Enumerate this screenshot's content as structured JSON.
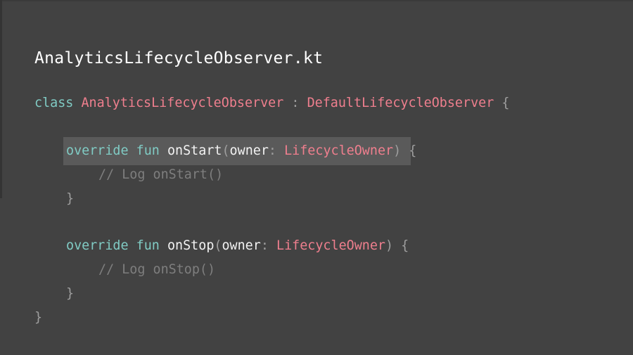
{
  "file_title": "AnalyticsLifecycleObserver.kt",
  "colors": {
    "background": "#424242",
    "keyword": "#80cbc4",
    "type": "#ef7f8e",
    "identifier": "#f2f2f2",
    "comment": "#7e7e7e",
    "highlight": "#5a5a5a"
  },
  "code": {
    "class_line": {
      "keyword": "class",
      "class_name": "AnalyticsLifecycleObserver",
      "separator": ":",
      "parent": "DefaultLifecycleObserver",
      "open_brace": "{"
    },
    "on_start": {
      "override_kw": "override",
      "fun_kw": "fun",
      "name": "onStart",
      "open_paren": "(",
      "param": "owner",
      "colon": ":",
      "param_type": "LifecycleOwner",
      "close_paren": ")",
      "open_brace": "{",
      "comment": "// Log onStart()",
      "close_brace": "}"
    },
    "on_stop": {
      "override_kw": "override",
      "fun_kw": "fun",
      "name": "onStop",
      "open_paren": "(",
      "param": "owner",
      "colon": ":",
      "param_type": "LifecycleOwner",
      "close_paren": ")",
      "open_brace": "{",
      "comment": "// Log onStop()",
      "close_brace": "}"
    },
    "class_close_brace": "}"
  }
}
